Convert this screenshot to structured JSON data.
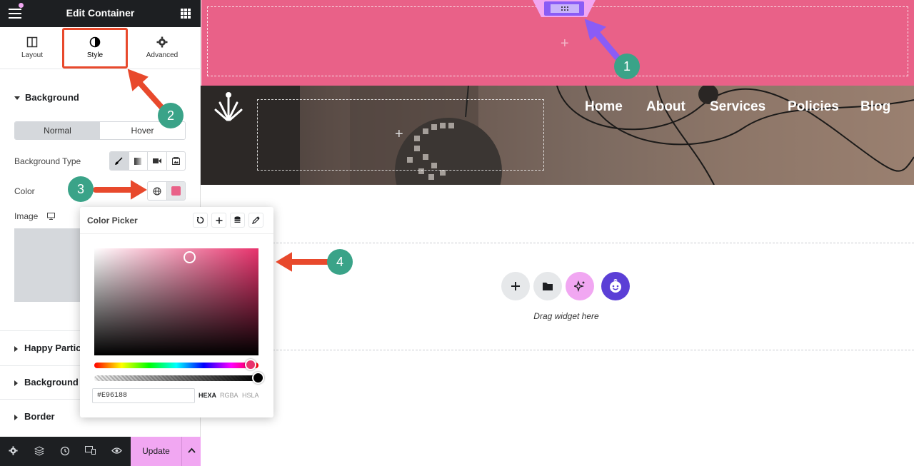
{
  "panel": {
    "title": "Edit Container",
    "tabs": [
      {
        "label": "Layout"
      },
      {
        "label": "Style"
      },
      {
        "label": "Advanced"
      }
    ],
    "sections": {
      "background": "Background",
      "happy_particle": "Happy Partic",
      "background_overlay": "Background",
      "border": "Border"
    },
    "state_switch": {
      "normal": "Normal",
      "hover": "Hover"
    },
    "bg_type_label": "Background Type",
    "color_label": "Color",
    "image_label": "Image",
    "accent_color": "#E96188"
  },
  "footer": {
    "update_label": "Update"
  },
  "picker": {
    "title": "Color Picker",
    "hex_value": "#E96188",
    "formats": [
      "HEXA",
      "RGBA",
      "HSLA"
    ]
  },
  "site": {
    "nav": [
      "Home",
      "About",
      "Services",
      "Policies",
      "Blog"
    ],
    "drag_text": "Drag widget here"
  },
  "annotations": [
    "1",
    "2",
    "3",
    "4"
  ]
}
